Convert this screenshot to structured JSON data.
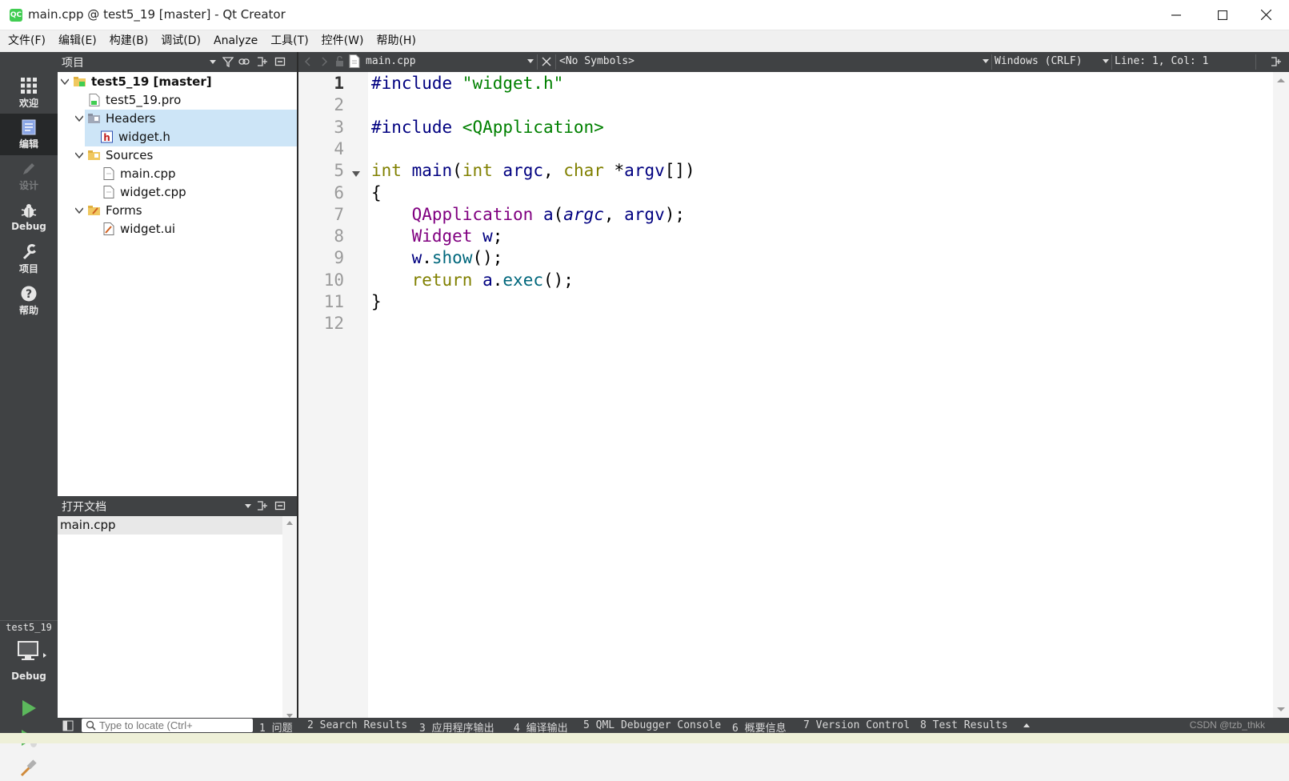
{
  "window": {
    "title": "main.cpp @ test5_19 [master] - Qt Creator",
    "app_icon_text": "QC"
  },
  "menu": [
    "文件(F)",
    "编辑(E)",
    "构建(B)",
    "调试(D)",
    "Analyze",
    "工具(T)",
    "控件(W)",
    "帮助(H)"
  ],
  "modes": [
    {
      "label": "欢迎",
      "icon": "grid-icon"
    },
    {
      "label": "编辑",
      "icon": "edit-document-icon"
    },
    {
      "label": "设计",
      "icon": "pencil-icon"
    },
    {
      "label": "Debug",
      "icon": "bug-icon"
    },
    {
      "label": "项目",
      "icon": "wrench-icon"
    },
    {
      "label": "帮助",
      "icon": "help-icon"
    }
  ],
  "kit": {
    "name": "test5_19",
    "build_mode": "Debug"
  },
  "project_pane": {
    "title": "项目",
    "tree": [
      {
        "label": "test5_19 [master]",
        "type": "project"
      },
      {
        "label": "test5_19.pro",
        "type": "pro-file"
      },
      {
        "label": "Headers",
        "type": "folder"
      },
      {
        "label": "widget.h",
        "type": "header-file"
      },
      {
        "label": "Sources",
        "type": "folder"
      },
      {
        "label": "main.cpp",
        "type": "source-file"
      },
      {
        "label": "widget.cpp",
        "type": "source-file"
      },
      {
        "label": "Forms",
        "type": "folder"
      },
      {
        "label": "widget.ui",
        "type": "form-file"
      }
    ]
  },
  "open_documents": {
    "title": "打开文档",
    "items": [
      "main.cpp"
    ]
  },
  "editor": {
    "file": "main.cpp",
    "symbols": "<No Symbols>",
    "line_ending": "Windows (CRLF)",
    "cursor": "Line: 1, Col: 1",
    "current_line": 1,
    "lines": [
      [
        [
          "#include ",
          "pp"
        ],
        [
          "\"widget.h\"",
          "str"
        ]
      ],
      [],
      [
        [
          "#include ",
          "pp"
        ],
        [
          "<QApplication>",
          "str"
        ]
      ],
      [],
      [
        [
          "int",
          "kw"
        ],
        [
          " ",
          ""
        ],
        [
          "main",
          "pp"
        ],
        [
          "(",
          ""
        ],
        [
          "int",
          "kw"
        ],
        [
          " ",
          ""
        ],
        [
          "argc",
          "pp"
        ],
        [
          ", ",
          ""
        ],
        [
          "char",
          "kw"
        ],
        [
          " *",
          ""
        ],
        [
          "argv",
          "pp"
        ],
        [
          "[])",
          ""
        ]
      ],
      [
        [
          "{",
          ""
        ]
      ],
      [
        [
          "    ",
          ""
        ],
        [
          "QApplication",
          "ty"
        ],
        [
          " ",
          ""
        ],
        [
          "a",
          "pp"
        ],
        [
          "(",
          ""
        ],
        [
          "argc",
          "pp it"
        ],
        [
          ", ",
          ""
        ],
        [
          "argv",
          "pp"
        ],
        [
          ");",
          ""
        ]
      ],
      [
        [
          "    ",
          ""
        ],
        [
          "Widget",
          "ty"
        ],
        [
          " ",
          ""
        ],
        [
          "w",
          "pp"
        ],
        [
          ";",
          ""
        ]
      ],
      [
        [
          "    ",
          ""
        ],
        [
          "w",
          "pp"
        ],
        [
          ".",
          ""
        ],
        [
          "show",
          "fn"
        ],
        [
          "();",
          ""
        ]
      ],
      [
        [
          "    ",
          ""
        ],
        [
          "return",
          "kw"
        ],
        [
          " ",
          ""
        ],
        [
          "a",
          "pp"
        ],
        [
          ".",
          ""
        ],
        [
          "exec",
          "fn"
        ],
        [
          "();",
          ""
        ]
      ],
      [
        [
          "}",
          ""
        ]
      ],
      []
    ]
  },
  "bottom": {
    "locator_placeholder": "Type to locate (Ctrl+",
    "tabs": [
      "1 问题",
      "2 Search Results",
      "3 应用程序输出",
      "4 编译输出",
      "5 QML Debugger Console",
      "6 概要信息",
      "7 Version Control",
      "8 Test Results"
    ],
    "watermark": "CSDN @tzb_thkk"
  },
  "colors": {
    "sidebar": "#404244",
    "active_mode": "#262829",
    "selection": "#cde5f7",
    "run_green": "#5cb85c"
  }
}
